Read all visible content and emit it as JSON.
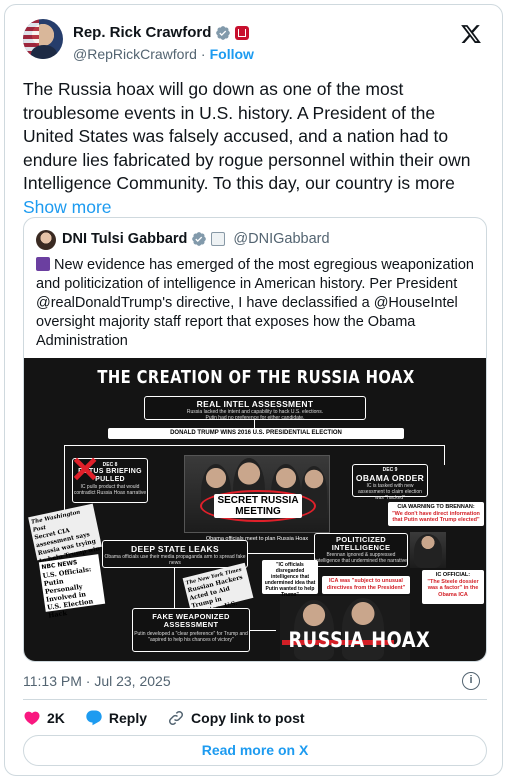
{
  "author": {
    "name": "Rep. Rick Crawford",
    "handle": "@RepRickCrawford",
    "separator": "·",
    "follow_label": "Follow"
  },
  "tweet": {
    "text": "The Russia hoax will go down as one of the most troublesome events in U.S. history. A President of the United States was falsely accused, and a nation had to endure lies fabricated by rogue personnel within their own Intelligence Community. To this day, our country is more",
    "show_more": "Show more"
  },
  "quote": {
    "name": "DNI Tulsi Gabbard",
    "handle": "@DNIGabbard",
    "text": "New evidence has emerged of the most egregious weaponization and politicization of intelligence in American history. Per President @realDonaldTrump's directive, I have declassified a @HouseIntel oversight majority staff report that exposes how the Obama Administration"
  },
  "infographic": {
    "title": "THE CREATION OF THE RUSSIA HOAX",
    "real_intel": {
      "title": "REAL INTEL ASSESSMENT",
      "sub1": "Russia lacked the intent and capability to hack U.S. elections.",
      "sub2": "Putin had no preference for either candidate."
    },
    "trump_wins": "DONALD TRUMP WINS 2016 U.S. PRESIDENTIAL ELECTION",
    "potus": {
      "date": "DEC 8",
      "title": "POTUS BRIEFING PULLED",
      "sub": "IC pulls product that would contradict Russia Hoax narrative"
    },
    "secret_meeting": {
      "line1": "SECRET RUSSIA",
      "line2": "MEETING",
      "caption": "Obama officials meet to plan Russia Hoax"
    },
    "obama_order": {
      "date": "DEC 9",
      "title": "OBAMA ORDER",
      "sub": "IC is tasked with new assessment to claim election was \"hacked\""
    },
    "cia_warning": {
      "title": "CIA WARNING TO BRENNAN:",
      "quote": "\"We don't have direct information that Putin wanted Trump elected\""
    },
    "deep_state": {
      "title": "DEEP STATE LEAKS",
      "sub": "Obama officials use their media propaganda arm to spread fake news"
    },
    "politicized": {
      "title": "POLITICIZED INTELLIGENCE",
      "sub": "Brennan ignored & suppressed intelligence that undermined the narrative"
    },
    "clip_wapo": {
      "masthead": "The Washington Post",
      "headline": "Secret CIA assessment says Russia was trying to help Trump win White House"
    },
    "clip_nbc": {
      "masthead": "NBC NEWS",
      "headline": "U.S. Officials: Putin Personally Involved in U.S. Election Hack"
    },
    "clip_nyt": {
      "masthead": "The New York Times",
      "headline": "Russian Hackers Acted to Aid Trump in Election, U.S. Says"
    },
    "ic_disregarded": "\"IC officials disregarded intelligence that undermined idea that Putin wanted to help Trump\"",
    "ica_was": "ICA was \"subject to unusual directives from the President\"",
    "ic_official": {
      "title": "IC OFFICIAL:",
      "text": "\"The Steele dossier was a factor\" in the Obama ICA"
    },
    "fake_assessment": {
      "title": "FAKE WEAPONIZED ASSESSMENT",
      "sub": "Putin developed a \"clear preference\" for Trump and \"aspired to help his chances of victory\""
    },
    "hoax_label": "RUSSIA HOAX"
  },
  "meta": {
    "timestamp": "11:13 PM · Jul 23, 2025",
    "likes": "2K",
    "reply_label": "Reply",
    "copy_link_label": "Copy link to post",
    "read_more_label": "Read more on X"
  },
  "colors": {
    "accent": "#1d9bf0",
    "like": "#f91880",
    "muted": "#536471",
    "border": "#cfd9de",
    "infographic_red": "#d31f26"
  },
  "icons": {
    "verified": "verified-badge-icon",
    "committee": "committee-badge-icon",
    "x_logo": "x-logo-icon",
    "heart": "heart-icon",
    "reply": "reply-bubble-icon",
    "link": "link-icon",
    "info": "info-icon",
    "government_seal": "government-seal-icon",
    "scroll": "scroll-emoji-icon"
  }
}
